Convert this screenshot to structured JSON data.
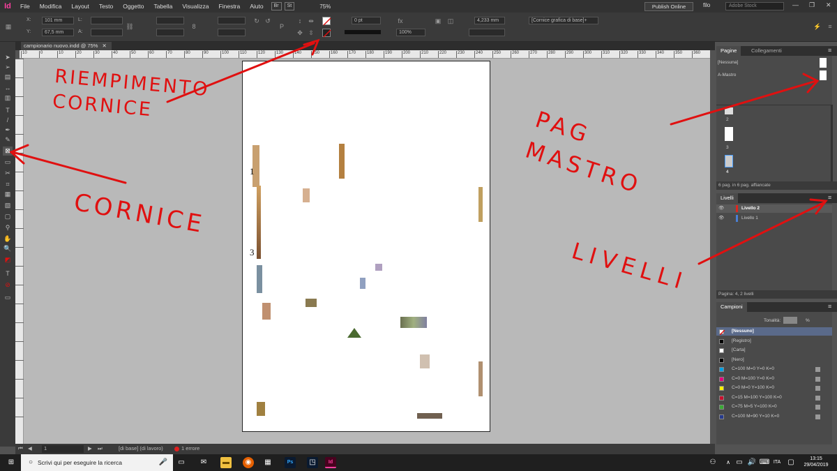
{
  "app": {
    "logo": "Id"
  },
  "menubar": {
    "items": [
      "File",
      "Modifica",
      "Layout",
      "Testo",
      "Oggetto",
      "Tabella",
      "Visualizza",
      "Finestra",
      "Aiuto"
    ],
    "btn_br": "Br",
    "btn_st": "St",
    "zoom": "75%",
    "publish": "Publish Online",
    "user": "filo",
    "stock_placeholder": "Adobe Stock"
  },
  "control": {
    "x_label": "X:",
    "x_value": "101 mm",
    "y_label": "Y:",
    "y_value": "67,5 mm",
    "w_label": "L:",
    "h_label": "A:",
    "stroke_weight": "0 pt",
    "opacity": "100%",
    "measure": "4,233 mm",
    "style": "[Cornice grafica di base]+"
  },
  "document": {
    "tab_title": "campionario nuovo.indd @ 75%",
    "page_numbers": [
      "1",
      "3"
    ]
  },
  "ruler": {
    "ticks": [
      "10",
      "0",
      "10",
      "20",
      "30",
      "40",
      "50",
      "60",
      "70",
      "80",
      "90",
      "100",
      "110",
      "120",
      "130",
      "140",
      "150",
      "160",
      "170",
      "180",
      "190",
      "200",
      "210",
      "220",
      "230",
      "240",
      "250",
      "260",
      "270",
      "280",
      "290",
      "300",
      "310",
      "320",
      "330",
      "340",
      "350",
      "360"
    ]
  },
  "status": {
    "page": "1",
    "profile": "[di base] (di lavoro)",
    "errors": "1 errore"
  },
  "pages_panel": {
    "tabs": [
      "Pagine",
      "Collegamenti"
    ],
    "masters": [
      "[Nessuna]",
      "A-Mastro"
    ],
    "page_labels": [
      "2",
      "3",
      "4"
    ],
    "footer": "6 pag. in 6 pag. affiancate"
  },
  "layers_panel": {
    "title": "Livelli",
    "layers": [
      {
        "name": "Livello 2",
        "color": "#e0261f"
      },
      {
        "name": "Livello 1",
        "color": "#4a7fd4"
      }
    ],
    "footer": "Pagina: 4, 2 livelli"
  },
  "swatches_panel": {
    "title": "Campioni",
    "tint_label": "Tonalità:",
    "tint_unit": "%",
    "swatches": [
      {
        "name": "[Nessuno]",
        "color": "#ffffff"
      },
      {
        "name": "[Registro]",
        "color": "#000000"
      },
      {
        "name": "[Carta]",
        "color": "#ffffff"
      },
      {
        "name": "[Nero]",
        "color": "#000000"
      },
      {
        "name": "C=100 M=0 Y=0 K=0",
        "color": "#00a0e4"
      },
      {
        "name": "C=0 M=100 Y=0 K=0",
        "color": "#e4007c"
      },
      {
        "name": "C=0 M=0 Y=100 K=0",
        "color": "#fff200"
      },
      {
        "name": "C=15 M=100 Y=100 K=0",
        "color": "#c8102e"
      },
      {
        "name": "C=75 M=5 Y=100 K=0",
        "color": "#3aa935"
      },
      {
        "name": "C=100 M=90 Y=10 K=0",
        "color": "#263a8c"
      }
    ]
  },
  "annotations": {
    "fill": "RIEMPIMENTO\nCORNICE",
    "frame": "CORNICE",
    "master": "PAG\nMASTRO",
    "layers": "LIVELLI"
  },
  "taskbar": {
    "search_placeholder": "Scrivi qui per eseguire la ricerca",
    "time": "13:15",
    "date": "29/04/2019"
  },
  "colors": {
    "annotation": "#e01010",
    "indesign": "#ff3fa0"
  }
}
